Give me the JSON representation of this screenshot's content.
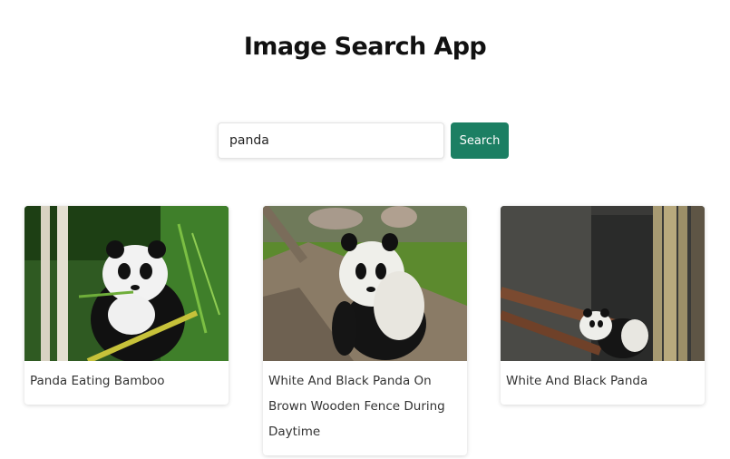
{
  "app": {
    "title": "Image Search App"
  },
  "search": {
    "value": "panda",
    "placeholder": "",
    "button_label": "Search"
  },
  "results": [
    {
      "caption": "Panda Eating Bamboo"
    },
    {
      "caption": "White And Black Panda On Brown Wooden Fence During Daytime"
    },
    {
      "caption": "White And Black Panda"
    }
  ],
  "colors": {
    "accent": "#1c7f63",
    "text": "#333333",
    "title": "#111111"
  }
}
